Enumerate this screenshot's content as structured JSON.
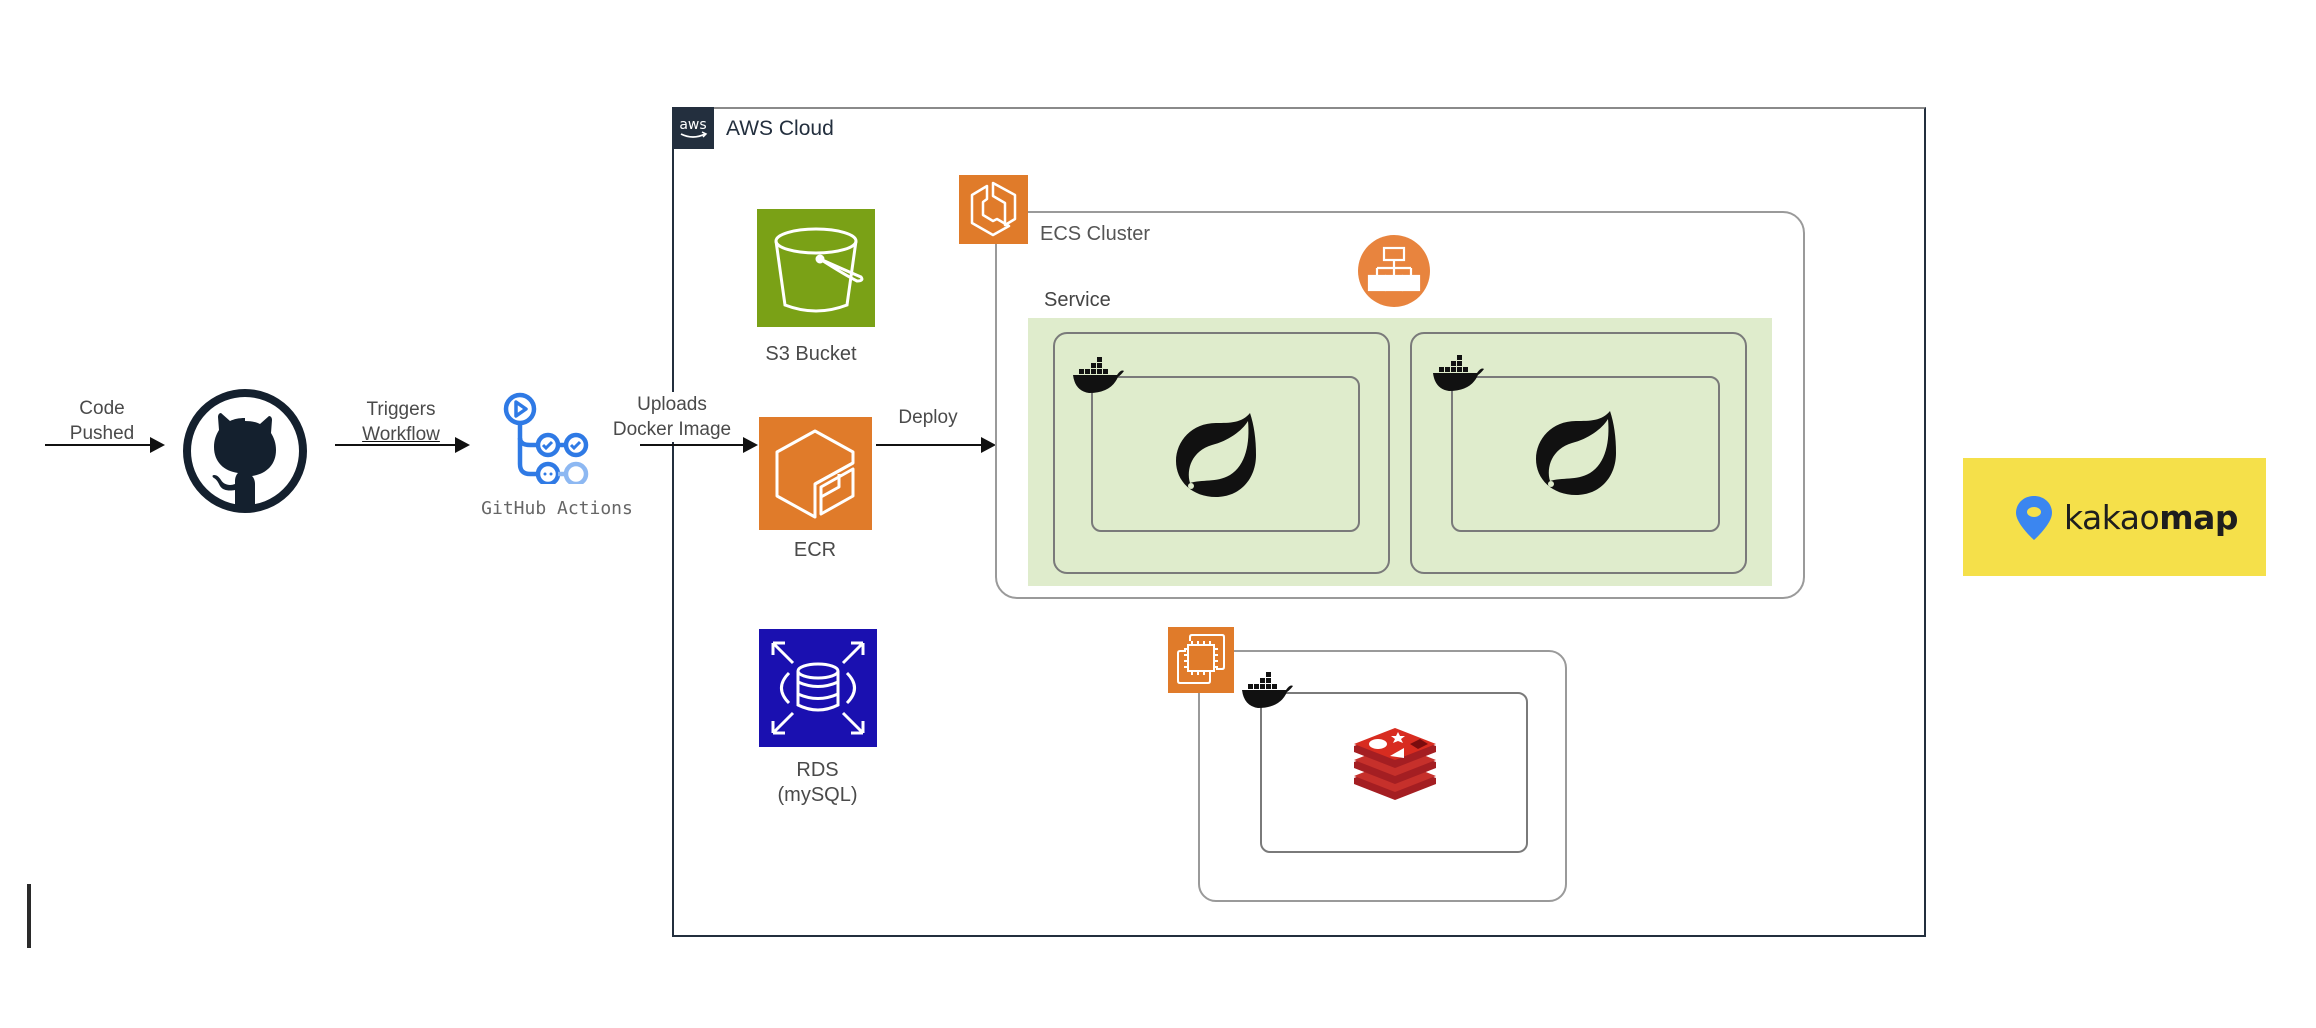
{
  "diagram": {
    "edges": [
      {
        "id": "code-pushed",
        "label_line1": "Code",
        "label_line2": "Pushed"
      },
      {
        "id": "triggers-workflow",
        "label_line1": "Triggers",
        "label_line2": "Workflow"
      },
      {
        "id": "uploads-docker-image",
        "label_line1": "Uploads",
        "label_line2": "Docker Image"
      },
      {
        "id": "deploy",
        "label_line1": "Deploy"
      }
    ],
    "nodes": {
      "github": {
        "icon": "github-octocat-icon"
      },
      "github_actions": {
        "label": "GitHub Actions",
        "icon": "github-actions-icon"
      },
      "aws_cloud": {
        "label": "AWS Cloud",
        "badge_text": "aws"
      },
      "s3": {
        "label": "S3 Bucket",
        "color": "#7aa116"
      },
      "ecr": {
        "label": "ECR",
        "color": "#e07b2a"
      },
      "rds": {
        "label_line1": "RDS",
        "label_line2": "(mySQL)",
        "color": "#1a10b0"
      },
      "ecs_cluster": {
        "label": "ECS Cluster",
        "color": "#e07b2a"
      },
      "load_balancer": {
        "icon": "elastic-load-balancer-icon",
        "color": "#e8843e"
      },
      "service": {
        "label": "Service",
        "fill": "#dfeccc"
      },
      "tasks": [
        {
          "container_icon": "docker-icon",
          "app_icon": "spring-boot-icon"
        },
        {
          "container_icon": "docker-icon",
          "app_icon": "spring-boot-icon"
        }
      ],
      "ec2": {
        "icon": "ec2-instance-icon",
        "color": "#e07b2a",
        "container_icon": "docker-icon",
        "app_icon": "redis-icon"
      },
      "kakaomap": {
        "text_regular": "kakao",
        "text_bold": "map",
        "bg": "#f5e04a",
        "pin_color": "#3b86f0"
      }
    }
  }
}
